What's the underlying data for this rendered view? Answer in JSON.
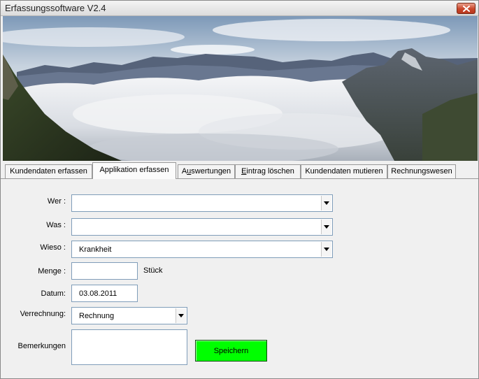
{
  "window": {
    "title": "Erfassungssoftware V2.4",
    "close_icon": "close-icon"
  },
  "banner": {
    "description_icon": "mountain-sea-of-clouds-photo"
  },
  "tabs": [
    {
      "label": "Kundendaten erfassen",
      "accesskey_index": -1,
      "active": false
    },
    {
      "label": "Applikation erfassen",
      "accesskey_index": 0,
      "active": true
    },
    {
      "label_pre": "A",
      "label_ul": "u",
      "label_post": "swertungen",
      "active": false
    },
    {
      "label_pre": "",
      "label_ul": "E",
      "label_post": "intrag löschen",
      "active": false
    },
    {
      "label": "Kundendaten mutieren",
      "active": false
    },
    {
      "label": "Rechnungswesen",
      "active": false
    }
  ],
  "form": {
    "wer": {
      "label": "Wer :",
      "value": ""
    },
    "was": {
      "label": "Was :",
      "value": ""
    },
    "wieso": {
      "label": "Wieso :",
      "value": "Krankheit"
    },
    "menge": {
      "label": "Menge :",
      "value": "",
      "unit": "Stück"
    },
    "datum": {
      "label": "Datum:",
      "value": "03.08.2011"
    },
    "verrechnung": {
      "label": "Verrechnung:",
      "value": "Rechnung"
    },
    "bemerkungen": {
      "label": "Bemerkungen",
      "value": ""
    },
    "save_label": "Speichern"
  },
  "colors": {
    "save_button": "#00ff00",
    "close_button": "#c9452a"
  }
}
